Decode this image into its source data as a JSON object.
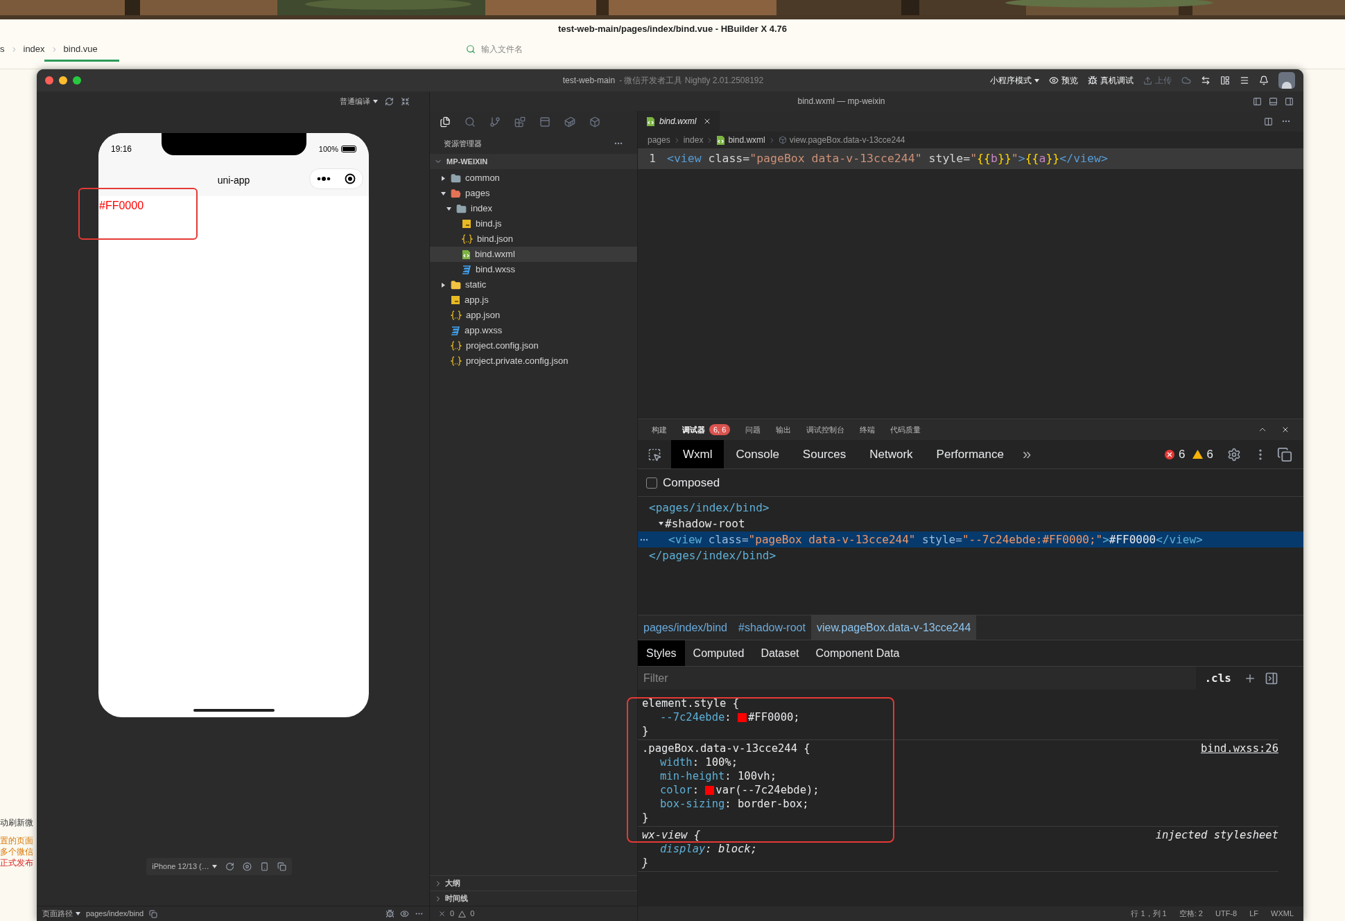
{
  "hbuilder": {
    "title": "test-web-main/pages/index/bind.vue - HBuilder X 4.76",
    "breadcrumb": [
      "s",
      "index",
      "bind.vue"
    ],
    "file_search": {
      "placeholder": "输入文件名"
    },
    "side_texts": [
      {
        "text": "动刷新微",
        "kind": "plain"
      },
      {
        "text": "置的页面",
        "kind": "warn"
      },
      {
        "text": "多个微信",
        "kind": "warn"
      },
      {
        "text": "正式发布",
        "kind": "error"
      }
    ]
  },
  "devtools": {
    "title": "test-web-main",
    "subtitle": "- 微信开发者工具 Nightly 2.01.2508192",
    "toolbar": [
      {
        "label": "小程序模式",
        "kind": "dropdown",
        "disabled": false
      },
      {
        "label": "预览",
        "kind": "eye",
        "disabled": false
      },
      {
        "label": "真机调试",
        "kind": "bug",
        "disabled": false
      },
      {
        "label": "上传",
        "kind": "upload",
        "disabled": true
      }
    ],
    "simulator": {
      "compile_mode": "普通编译",
      "phone": {
        "time": "19:16",
        "battery": "100%",
        "nav_title": "uni-app",
        "content": "#FF0000"
      },
      "device": "iPhone 12/13 (…",
      "page_path_label": "页面路径",
      "page_path": "pages/index/bind"
    },
    "editor_window_title": "bind.wxml — mp-weixin",
    "explorer": {
      "title": "资源管理器",
      "project": "MP-WEIXIN",
      "tree": [
        {
          "name": "common",
          "kind": "folder",
          "expanded": false,
          "selected": false
        },
        {
          "name": "pages",
          "kind": "pages-folder",
          "expanded": true,
          "selected": false,
          "children": [
            {
              "name": "index",
              "kind": "folder",
              "expanded": true,
              "selected": false,
              "children": [
                {
                  "name": "bind.js",
                  "kind": "js",
                  "selected": false
                },
                {
                  "name": "bind.json",
                  "kind": "json",
                  "selected": false
                },
                {
                  "name": "bind.wxml",
                  "kind": "wxml",
                  "selected": true
                },
                {
                  "name": "bind.wxss",
                  "kind": "wxss",
                  "selected": false
                }
              ]
            }
          ]
        },
        {
          "name": "static",
          "kind": "static-folder",
          "expanded": false,
          "selected": false
        },
        {
          "name": "app.js",
          "kind": "js",
          "selected": false
        },
        {
          "name": "app.json",
          "kind": "json",
          "selected": false
        },
        {
          "name": "app.wxss",
          "kind": "wxss",
          "selected": false
        },
        {
          "name": "project.config.json",
          "kind": "json",
          "selected": false
        },
        {
          "name": "project.private.config.json",
          "kind": "json",
          "selected": false
        }
      ],
      "sections": [
        "大纲",
        "时间线"
      ],
      "errors": "0",
      "warnings": "0"
    },
    "editor": {
      "tab": "bind.wxml",
      "breadcrumb": [
        "pages",
        "index",
        "bind.wxml",
        "view.pageBox.data-v-13cce244"
      ],
      "lines": [
        {
          "number": "1",
          "tokens": [
            {
              "kind": "tag",
              "text": "<view"
            },
            {
              "kind": "attr",
              "text": " class="
            },
            {
              "kind": "string",
              "text": "\"pageBox data-v-13cce244\""
            },
            {
              "kind": "attr",
              "text": " style="
            },
            {
              "kind": "string",
              "text": "\""
            },
            {
              "kind": "brace",
              "text": "{{"
            },
            {
              "kind": "var",
              "text": "b"
            },
            {
              "kind": "brace",
              "text": "}}"
            },
            {
              "kind": "string",
              "text": "\""
            },
            {
              "kind": "tag",
              "text": ">"
            },
            {
              "kind": "brace",
              "text": "{{"
            },
            {
              "kind": "var",
              "text": "a"
            },
            {
              "kind": "brace",
              "text": "}}"
            },
            {
              "kind": "tag",
              "text": "</view>"
            }
          ]
        }
      ]
    },
    "panel": {
      "tabs": [
        {
          "label": "构建",
          "selected": false
        },
        {
          "label": "调试器",
          "selected": true,
          "badge": "6, 6"
        },
        {
          "label": "问题",
          "selected": false
        },
        {
          "label": "输出",
          "selected": false
        },
        {
          "label": "调试控制台",
          "selected": false
        },
        {
          "label": "终端",
          "selected": false
        },
        {
          "label": "代码质量",
          "selected": false
        }
      ],
      "devtools_tabs": [
        {
          "label": "Wxml",
          "selected": true
        },
        {
          "label": "Console",
          "selected": false
        },
        {
          "label": "Sources",
          "selected": false
        },
        {
          "label": "Network",
          "selected": false
        },
        {
          "label": "Performance",
          "selected": false
        }
      ],
      "more": "»",
      "errors": "6",
      "warnings": "6",
      "composed": {
        "label": "Composed",
        "checked": false
      },
      "dom": [
        {
          "selected": false,
          "tokens": [
            {
              "kind": "tag",
              "text": "<pages/index/bind>"
            }
          ],
          "children": [
            {
              "selected": false,
              "expanded": true,
              "tokens": [
                {
                  "kind": "text",
                  "text": "#shadow-root"
                }
              ],
              "children": [
                {
                  "selected": true,
                  "tokens": [
                    {
                      "kind": "tag",
                      "text": "<view"
                    },
                    {
                      "kind": "attr",
                      "text": " class="
                    },
                    {
                      "kind": "string",
                      "text": "\"pageBox data-v-13cce244\""
                    },
                    {
                      "kind": "attr",
                      "text": " style="
                    },
                    {
                      "kind": "string",
                      "text": "\"--7c24ebde:#FF0000;\""
                    },
                    {
                      "kind": "tag",
                      "text": ">"
                    },
                    {
                      "kind": "text",
                      "text": "#FF0000"
                    },
                    {
                      "kind": "tag",
                      "text": "</view>"
                    }
                  ]
                }
              ]
            }
          ]
        },
        {
          "selected": false,
          "tokens": [
            {
              "kind": "tag",
              "text": "</pages/index/bind>"
            }
          ]
        }
      ],
      "path": [
        {
          "label": "pages/index/bind",
          "selected": false
        },
        {
          "label": "#shadow-root",
          "selected": false
        },
        {
          "label": "view.pageBox.data-v-13cce244",
          "selected": true
        }
      ],
      "style_tabs": [
        {
          "label": "Styles",
          "selected": true
        },
        {
          "label": "Computed",
          "selected": false
        },
        {
          "label": "Dataset",
          "selected": false
        },
        {
          "label": "Component Data",
          "selected": false
        }
      ],
      "filter": {
        "placeholder": "Filter"
      },
      "cls": ".cls",
      "rules": [
        {
          "selector": "element.style {",
          "italic": false,
          "props": [
            {
              "name": "--7c24ebde",
              "colon": ":",
              "color": "#ff0000",
              "value": "#FF0000;"
            }
          ],
          "close": "}"
        },
        {
          "selector": ".pageBox.data-v-13cce244 {",
          "source": "bind.wxss:26",
          "italic": false,
          "props": [
            {
              "name": "width",
              "colon": ":",
              "value": "100%;"
            },
            {
              "name": "min-height",
              "colon": ":",
              "value": "100vh;"
            },
            {
              "name": "color",
              "colon": ":",
              "color": "#ff0000",
              "value": "var(--7c24ebde);"
            },
            {
              "name": "box-sizing",
              "colon": ":",
              "value": "border-box;"
            }
          ],
          "close": "}"
        },
        {
          "selector": "wx-view {",
          "source": "injected stylesheet",
          "italic": true,
          "props": [
            {
              "name": "display",
              "colon": ":",
              "value": "block;"
            }
          ],
          "close": "}"
        }
      ]
    },
    "status": [
      "行 1，列 1",
      "空格: 2",
      "UTF-8",
      "LF",
      "WXML"
    ]
  }
}
